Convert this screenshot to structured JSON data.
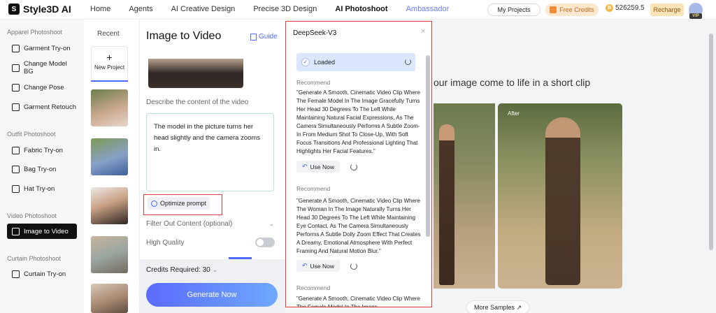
{
  "topbar": {
    "logo": "Style3D AI",
    "nav": [
      "Home",
      "Agents",
      "AI Creative Design",
      "Precise 3D Design",
      "AI Photoshoot",
      "Ambassador"
    ],
    "my_projects": "My Projects",
    "free_credits": "Free Credits",
    "balance": "526259.5",
    "recharge": "Recharge",
    "vip": "VIP"
  },
  "sidebar": {
    "sections": [
      {
        "title": "Apparel Photoshoot",
        "items": [
          "Garment Try-on",
          "Change Model BG",
          "Change Pose",
          "Garment Retouch"
        ]
      },
      {
        "title": "Outfit Photoshoot",
        "items": [
          "Fabric Try-on",
          "Bag Try-on",
          "Hat Try-on"
        ]
      },
      {
        "title": "Video Photoshoot",
        "items": [
          "Image to Video"
        ]
      },
      {
        "title": "Curtain Photoshoot",
        "items": [
          "Curtain Try-on"
        ]
      }
    ]
  },
  "recent": {
    "title": "Recent",
    "new_project": "New Project"
  },
  "form": {
    "title": "Image to Video",
    "guide": "Guide",
    "describe_label": "Describe the content of the video",
    "prompt": "The model in the picture turns her head slightly and the camera zooms in.",
    "optimize": "Optimize prompt",
    "filter_label": "Filter Out Content (optional)",
    "hq_label": "High Quality",
    "credits": "Credits Required: 30",
    "generate": "Generate Now"
  },
  "popup": {
    "title": "DeepSeek-V3",
    "status": "Loaded",
    "recommend_label": "Recommend",
    "use_now": "Use Now",
    "recommendations": [
      "\"Generate A Smooth, Cinematic Video Clip Where The Female Model In The Image Gracefully Turns Her Head 30 Degrees To The Left While Maintaining Natural Facial Expressions, As The Camera Simultaneously Performs A Subtle Zoom-In From Medium Shot To Close-Up, With Soft Focus Transitions And Professional Lighting That Highlights Her Facial Features.\"",
      "\"Generate A Smooth, Cinematic Video Clip Where The Woman In The Image Naturally Turns Her Head 30 Degrees To The Left While Maintaining Eye Contact, As The Camera Simultaneously Performs A Subtle Dolly Zoom Effect That Creates A Dreamy, Emotional Atmosphere With Perfect Framing And Natural Motion Blur.\"",
      "\"Generate A Smooth, Cinematic Video Clip Where The Female Model In The Image"
    ]
  },
  "showcase": {
    "heading": "our image come to life in a short clip",
    "after_label": "After",
    "more_samples": "More Samples"
  }
}
